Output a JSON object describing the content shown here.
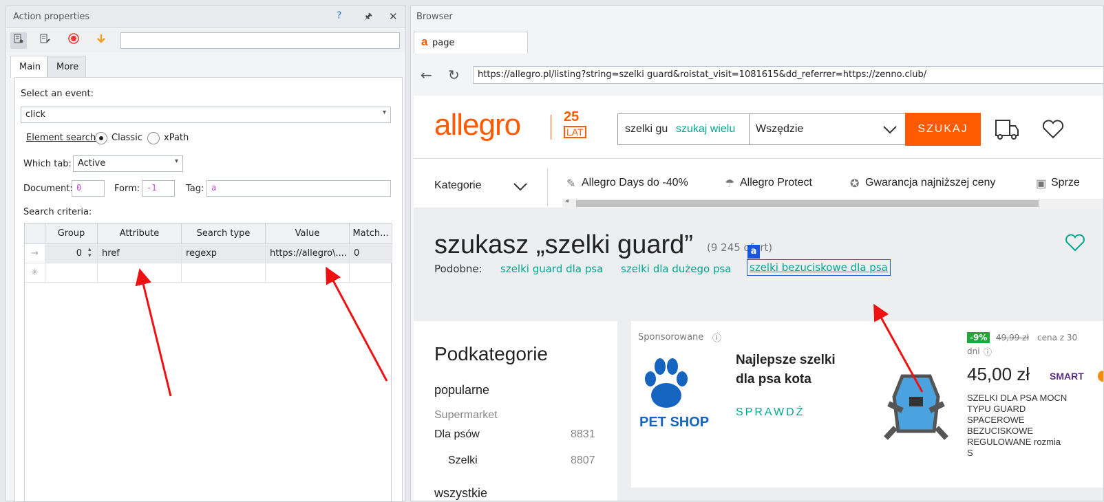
{
  "left": {
    "title": "Action properties",
    "help": "?",
    "pin": "⊼",
    "close": "✕",
    "tabs": [
      "Main",
      "More"
    ],
    "select_event_label": "Select an event:",
    "event_value": "click",
    "element_search_label": "Element search:",
    "search_mode_classic": "Classic",
    "search_mode_xpath": "xPath",
    "which_tab_label": "Which tab:",
    "which_tab_value": "Active",
    "document_label": "Document:",
    "document_value": "0",
    "form_label": "Form:",
    "form_value": "-1",
    "tag_label": "Tag:",
    "tag_value": "a",
    "search_criteria_label": "Search criteria:",
    "grid": {
      "headers": [
        "Group",
        "Attribute",
        "Search type",
        "Value",
        "Match..."
      ],
      "rows": [
        {
          "group": "0",
          "attribute": "href",
          "search_type": "regexp",
          "value": "https://allegro\\....",
          "match": "0"
        }
      ]
    }
  },
  "right": {
    "title": "Browser",
    "tab_label": "page",
    "tab_icon": "a",
    "url": "https://allegro.pl/listing?string=szelki guard&roistat_visit=1081615&dd_referrer=https://zenno.club/",
    "site": {
      "logo": "allegro",
      "logo_badge_top": "25",
      "logo_badge_bottom": "LAT",
      "search_value": "szelki gu",
      "search_hint": "szukaj wielu",
      "search_scope": "Wszędzie",
      "search_button": "SZUKAJ",
      "categories": "Kategorie",
      "menu": [
        "Allegro Days do -40%",
        "Allegro Protect",
        "Gwarancja najniższej ceny",
        "Sprze"
      ],
      "heading": "szukasz „szelki guard”",
      "count": "(9 245 ofert)",
      "similar_label": "Podobne:",
      "similar": [
        "szelki guard dla psa",
        "szelki dla dużego psa",
        "szelki bezuciskowe dla psa"
      ],
      "highlight_badge": "a",
      "subcat_title": "Podkategorie",
      "popular": "popularne",
      "supermarket": "Supermarket",
      "dla_psow": "Dla psów",
      "dla_psow_count": "8831",
      "szelki": "Szelki",
      "szelki_count": "8807",
      "wszystkie": "wszystkie",
      "sponsored": "Sponsorowane",
      "ad_title_1": "Najlepsze szelki",
      "ad_title_2": "dla psa kota",
      "ad_cta": "SPRAWDŹ",
      "pet_shop": "PET SHOP",
      "discount": "-9%",
      "old_price": "49,99 zł",
      "price_note": "cena z 30",
      "price_note_2": "dni",
      "price_main": "45,00 zł",
      "smart": "SMART",
      "product_lines": [
        "SZELKI DLA PSA MOCN",
        "TYPU GUARD",
        "SPACEROWE",
        "BEZUCISKOWE",
        "REGULOWANE rozmia",
        "S"
      ]
    }
  },
  "colors": {
    "accent_orange": "#ff5a00",
    "link_green": "#00a790",
    "arrow_red": "#e11",
    "highlight_blue": "#1a56db"
  }
}
